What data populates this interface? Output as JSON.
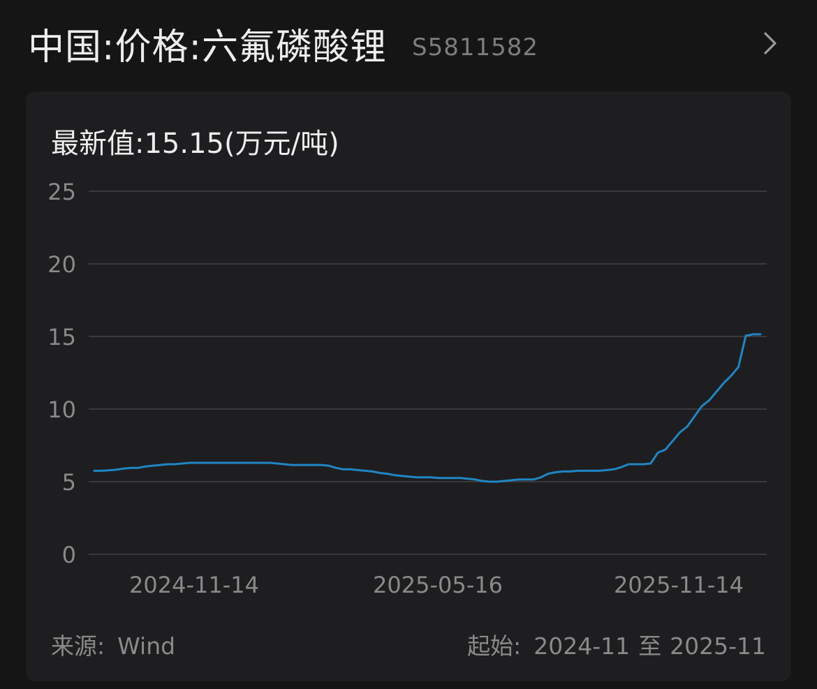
{
  "header": {
    "title": "中国:价格:六氟磷酸锂",
    "code": "S5811582",
    "chevron_icon": "chevron-right-icon"
  },
  "card": {
    "latest_label": "最新值:",
    "latest_value": "15.15",
    "latest_unit": "(万元/吨)",
    "source_label": "来源:",
    "source_value": "Wind",
    "range_label": "起始:",
    "range_start": "2024-11",
    "range_sep": "至",
    "range_end": "2025-11"
  },
  "colors": {
    "background": "#151515",
    "card": "#1e1e20",
    "line": "#1f86c4",
    "grid": "#3a3a3c",
    "tick_text": "#8a8a8a"
  },
  "chart_data": {
    "type": "line",
    "title": "",
    "xlabel": "",
    "ylabel": "",
    "ylim": [
      0,
      25
    ],
    "y_ticks": [
      "0",
      "5",
      "10",
      "15",
      "20",
      "25"
    ],
    "x_tick_labels": [
      "2024-11-14",
      "2025-05-16",
      "2025-11-14"
    ],
    "grid": true,
    "series": [
      {
        "values": [
          5.75,
          5.75,
          5.78,
          5.82,
          5.9,
          5.95,
          5.95,
          6.05,
          6.1,
          6.15,
          6.2,
          6.2,
          6.25,
          6.3,
          6.3,
          6.3,
          6.3,
          6.3,
          6.3,
          6.3,
          6.3,
          6.3,
          6.3,
          6.3,
          6.3,
          6.25,
          6.2,
          6.15,
          6.15,
          6.15,
          6.15,
          6.15,
          6.1,
          5.95,
          5.85,
          5.85,
          5.8,
          5.75,
          5.7,
          5.6,
          5.55,
          5.45,
          5.4,
          5.35,
          5.3,
          5.3,
          5.3,
          5.25,
          5.25,
          5.25,
          5.25,
          5.2,
          5.15,
          5.05,
          5.0,
          5.0,
          5.05,
          5.1,
          5.15,
          5.15,
          5.15,
          5.3,
          5.55,
          5.65,
          5.7,
          5.7,
          5.75,
          5.75,
          5.75,
          5.75,
          5.8,
          5.85,
          6.0,
          6.2,
          6.2,
          6.2,
          6.25,
          7.0,
          7.2,
          7.8,
          8.4,
          8.8,
          9.5,
          10.2,
          10.6,
          11.2,
          11.8,
          12.3,
          12.9,
          15.05,
          15.15,
          15.15
        ]
      }
    ]
  }
}
